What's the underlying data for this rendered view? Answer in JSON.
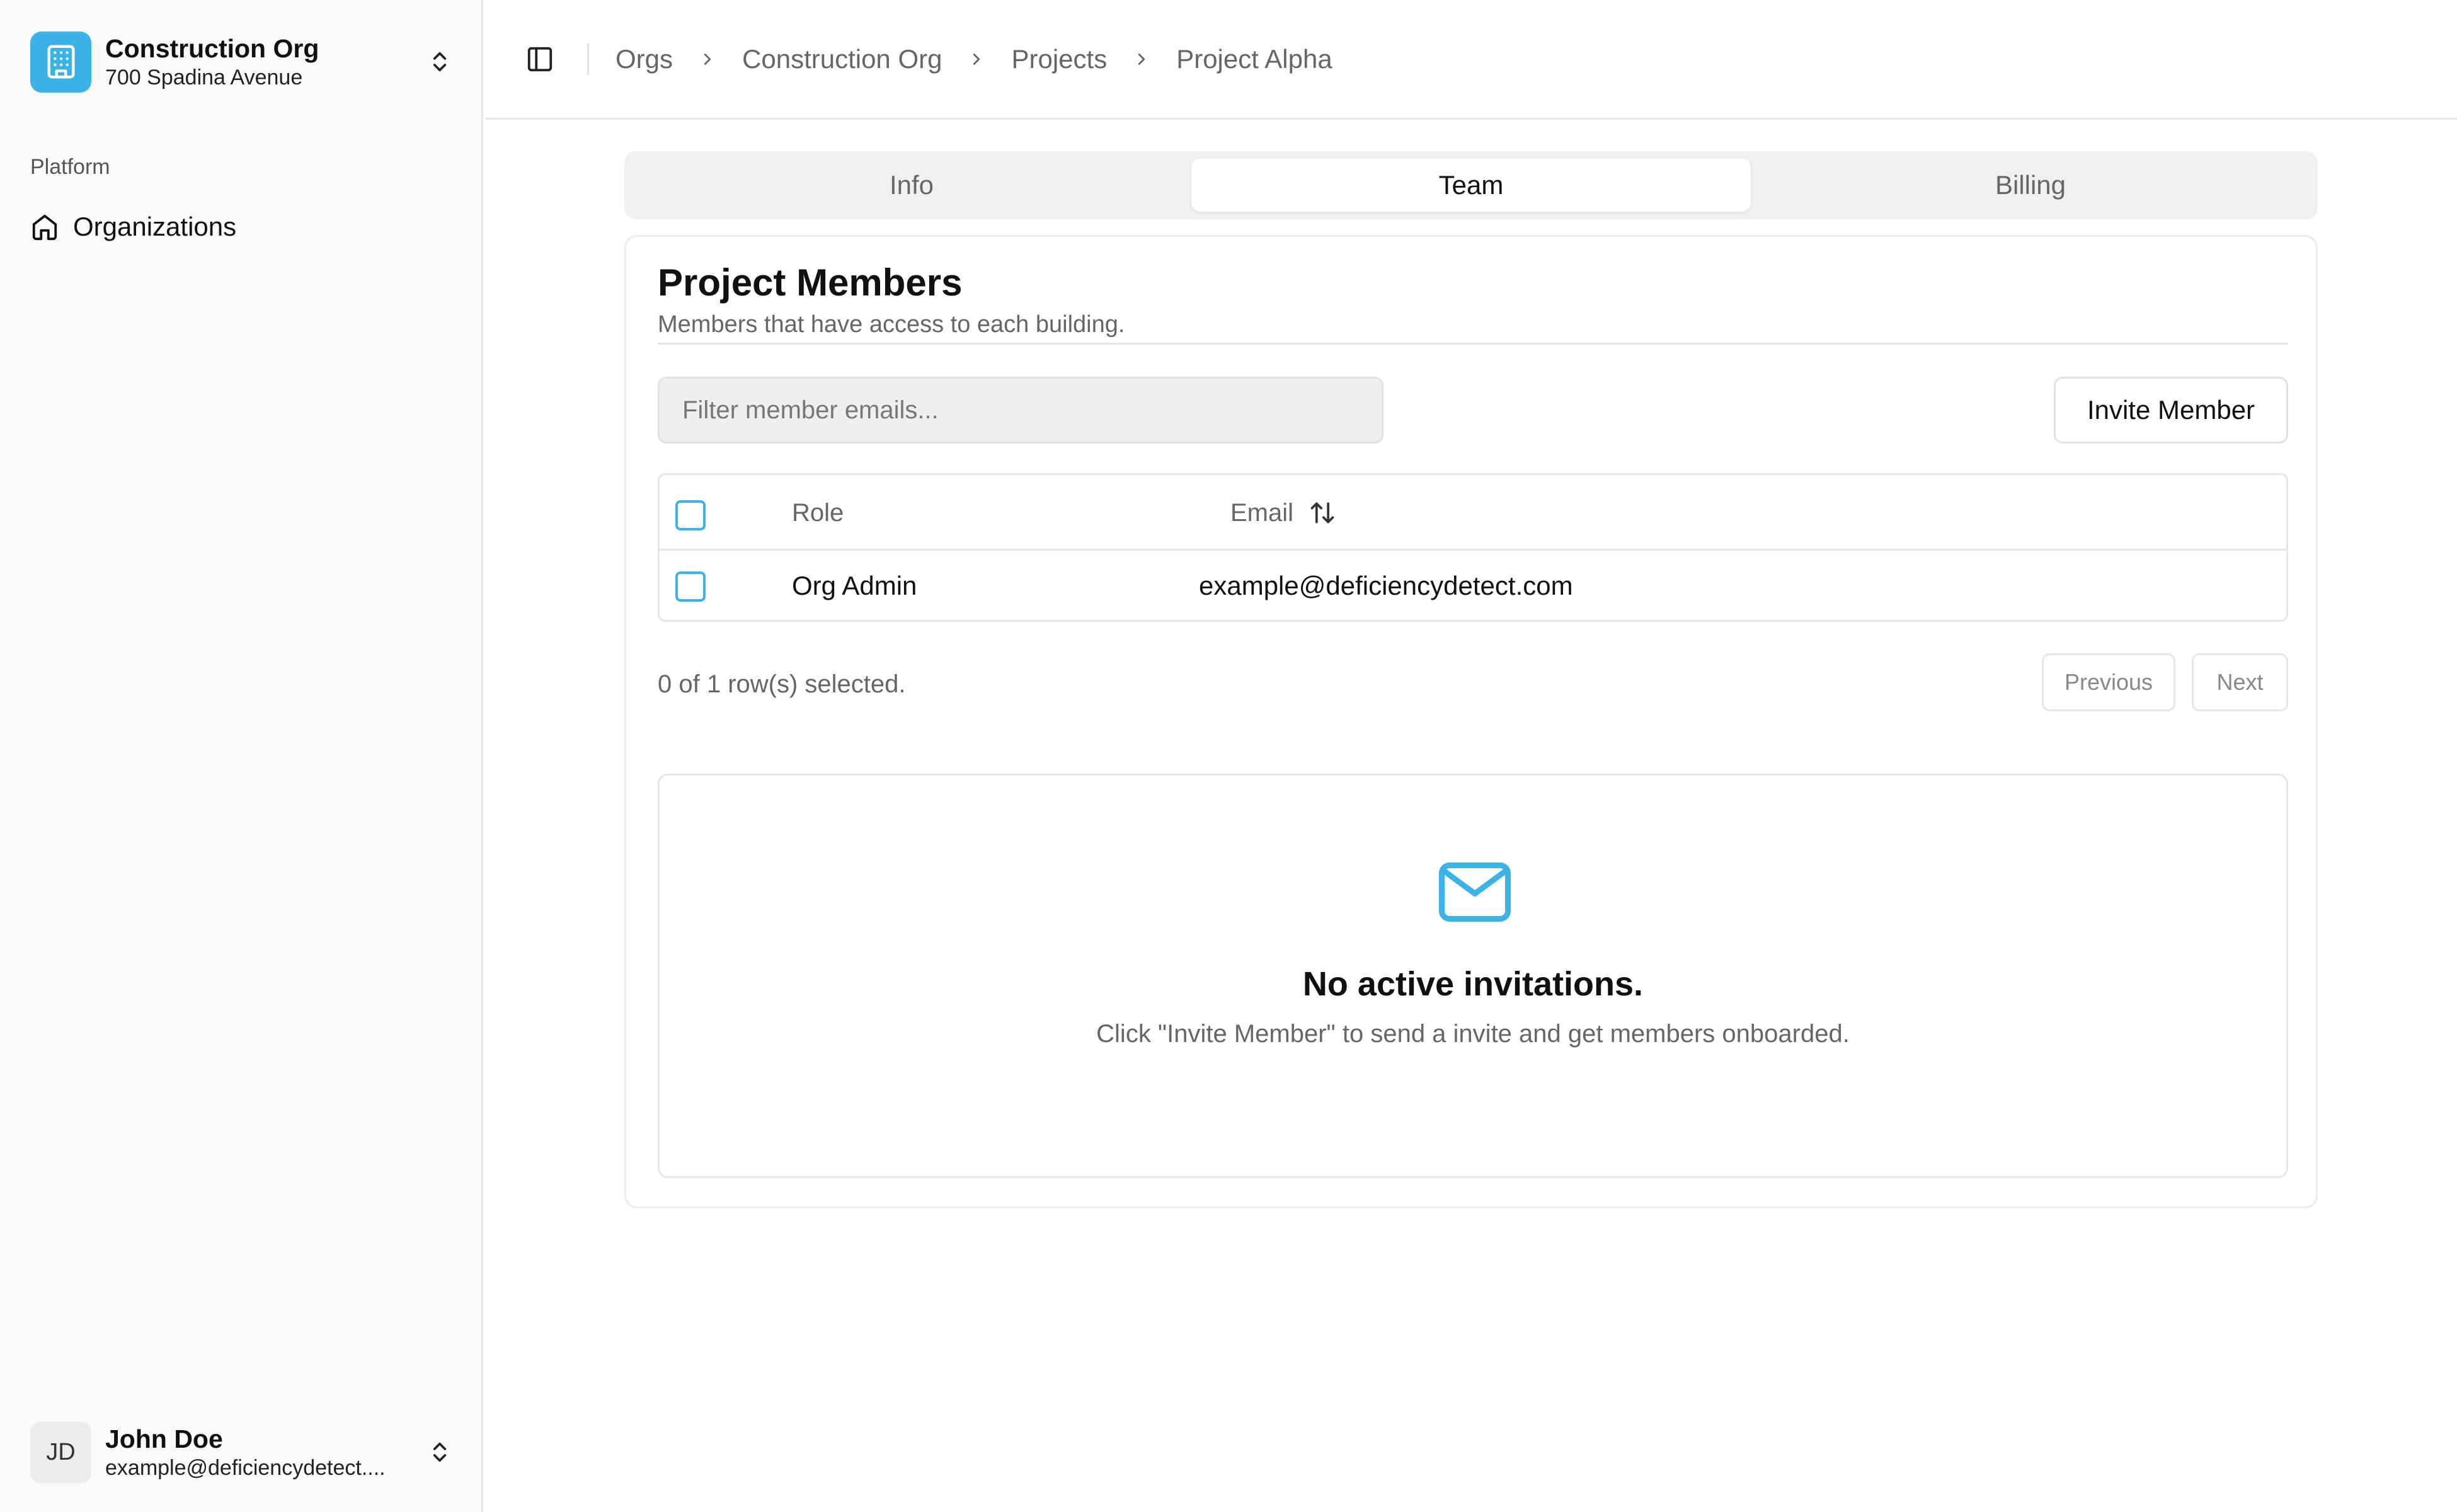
{
  "org": {
    "name": "Construction Org",
    "address": "700 Spadina Avenue"
  },
  "sidebar": {
    "section_label": "Platform",
    "items": [
      {
        "label": "Organizations",
        "icon": "home-icon"
      }
    ]
  },
  "user": {
    "initials": "JD",
    "name": "John Doe",
    "email": "example@deficiencydetect...."
  },
  "breadcrumb": [
    "Orgs",
    "Construction Org",
    "Projects",
    "Project Alpha"
  ],
  "tabs": [
    {
      "label": "Info",
      "active": false
    },
    {
      "label": "Team",
      "active": true
    },
    {
      "label": "Billing",
      "active": false
    }
  ],
  "members": {
    "title": "Project Members",
    "description": "Members that have access to each building.",
    "filter_placeholder": "Filter member emails...",
    "invite_label": "Invite Member",
    "columns": {
      "role": "Role",
      "email": "Email"
    },
    "rows": [
      {
        "role": "Org Admin",
        "email": "example@deficiencydetect.com"
      }
    ],
    "selected_text": "0 of 1 row(s) selected.",
    "previous_label": "Previous",
    "next_label": "Next"
  },
  "invitations": {
    "empty_title": "No active invitations.",
    "empty_desc": "Click \"Invite Member\" to send a invite and get members onboarded."
  },
  "colors": {
    "accent": "#3bb3e6",
    "sidebar_bg": "#fafafa",
    "tab_bg": "#f0f0f0"
  }
}
